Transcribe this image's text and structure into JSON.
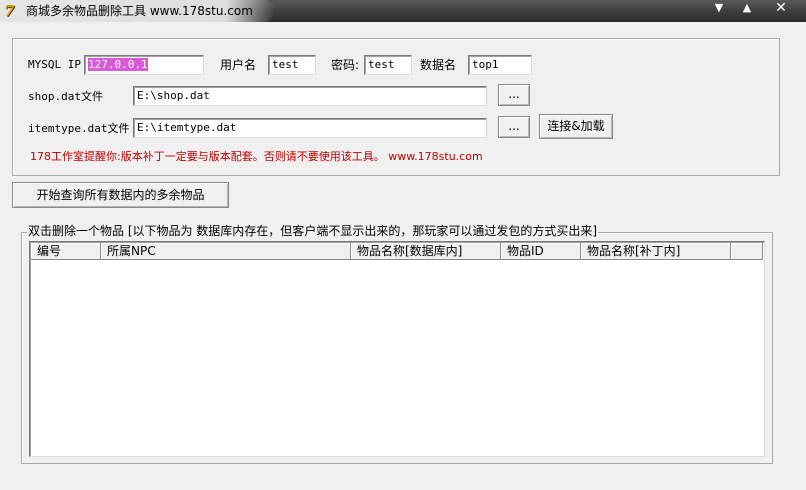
{
  "window": {
    "icon_glyph": "7",
    "title": "商城多余物品删除工具    www.178stu.com",
    "min_glyph": "▼",
    "max_glyph": "▲",
    "close_glyph": "✕"
  },
  "connection": {
    "mysql_ip_label": "MYSQL IP",
    "mysql_ip_value": "127.0.0.1",
    "username_label": "用户名",
    "username_value": "test",
    "password_label": "密码:",
    "password_value": "test",
    "dbname_label": "数据名",
    "dbname_value": "top1",
    "shop_label": "shop.dat文件",
    "shop_value": "E:\\shop.dat",
    "itemtype_label": "itemtype.dat文件",
    "itemtype_value": "E:\\itemtype.dat",
    "browse_label": "...",
    "connect_label": "连接&加载",
    "notice": "178工作室提醒你:版本补丁一定要与版本配套。否则请不要使用该工具。  www.178stu.com"
  },
  "query_button_label": "开始查询所有数据内的多余物品",
  "results": {
    "caption": "双击删除一个物品    [以下物品为 数据库内存在，但客户端不显示出来的，那玩家可以通过发包的方式买出来]",
    "columns": [
      "编号",
      "所属NPC",
      "物品名称[数据库内]",
      "物品ID",
      "物品名称[补丁内]"
    ],
    "rows": []
  }
}
